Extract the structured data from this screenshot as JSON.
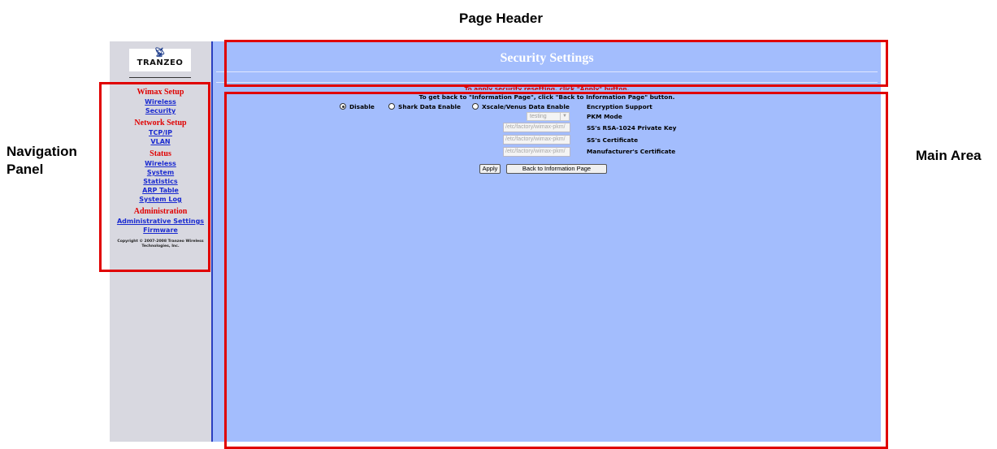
{
  "annotations": {
    "page_header": "Page Header",
    "navigation_panel": "Navigation Panel",
    "main_area": "Main Area"
  },
  "colors": {
    "annotation_box": "#e00000",
    "sidebar_bg": "#d8d8e0",
    "content_bg": "#a3bdfd",
    "section_title": "#e00000",
    "nav_link": "#1a2ad0",
    "divider": "#2a3fbf"
  },
  "sidebar": {
    "logo_text": "TRANZEO",
    "sections": [
      {
        "title": "Wimax Setup",
        "links": [
          "Wireless",
          "Security"
        ]
      },
      {
        "title": "Network Setup",
        "links": [
          "TCP/IP",
          "VLAN"
        ]
      },
      {
        "title": "Status",
        "links": [
          "Wireless",
          "System",
          "Statistics",
          "ARP Table",
          "System Log"
        ]
      },
      {
        "title": "Administration",
        "links": [
          "Administrative Settings",
          "Firmware"
        ]
      }
    ],
    "copyright": "Copyright © 2007-2008 Tranzeo Wireless Technologies, Inc."
  },
  "main": {
    "title": "Security Settings",
    "instruction_1": "To apply security resetting, click \"Apply\" button.",
    "instruction_2": "To get back to \"Information Page\", click \"Back to Information Page\" button.",
    "encryption": {
      "label": "Encryption Support",
      "options": [
        "Disable",
        "Shark Data Enable",
        "Xscale/Venus Data Enable"
      ],
      "selected": "Disable"
    },
    "pkm_mode": {
      "label": "PKM Mode",
      "value": "testing"
    },
    "private_key": {
      "label": "SS's RSA-1024 Private Key",
      "value": "/etc/factory/wimax-pkm/"
    },
    "ss_certificate": {
      "label": "SS's Certificate",
      "value": "/etc/factory/wimax-pkm/"
    },
    "manufacturer_certificate": {
      "label": "Manufacturer's Certificate",
      "value": "/etc/factory/wimax-pkm/"
    },
    "buttons": {
      "apply": "Apply",
      "back": "Back to Information Page"
    }
  }
}
